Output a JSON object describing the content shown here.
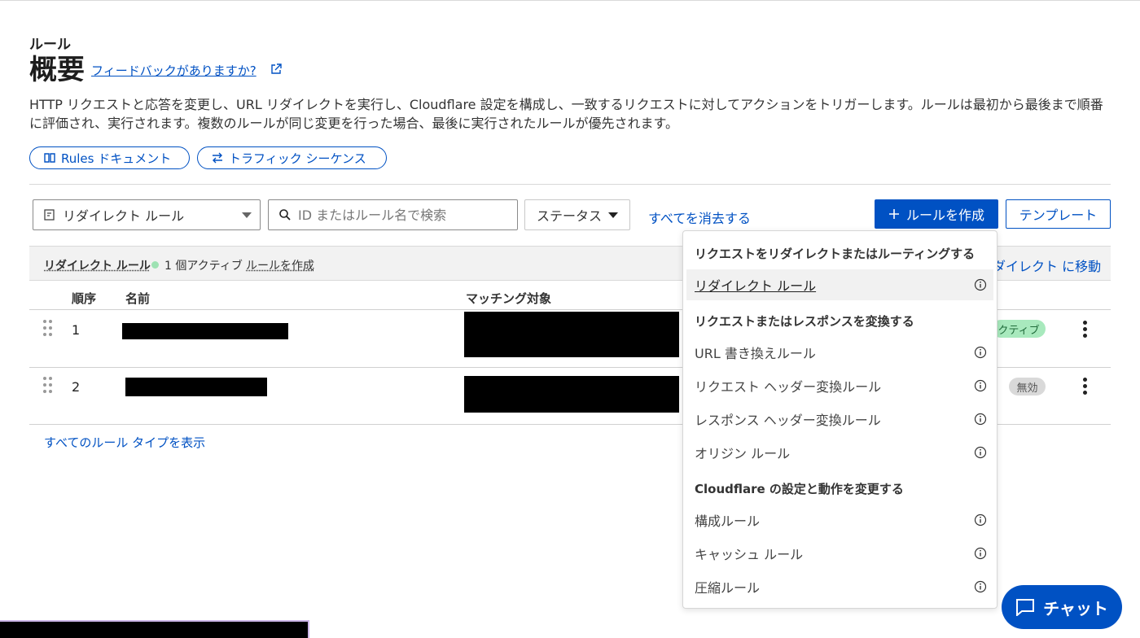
{
  "header": {
    "breadcrumb": "ルール",
    "title": "概要",
    "feedback_link": "フィードバックがありますか?",
    "description": "HTTP リクエストと応答を変更し、URL リダイレクトを実行し、Cloudflare 設定を構成し、一致するリクエストに対してアクションをトリガーします。ルールは最初から最後まで順番に評価され、実行されます。複数のルールが同じ変更を行った場合、最後に実行されたルールが優先されます。"
  },
  "pills": {
    "docs": "Rules ドキュメント",
    "sequence": "トラフィック シーケンス"
  },
  "toolbar": {
    "rule_type_select": "リダイレクト ルール",
    "search_placeholder": "ID またはルール名で検索",
    "status_filter": "ステータス",
    "clear_all": "すべてを消去する",
    "create_button": "ルールを作成",
    "template_button": "テンプレート"
  },
  "table": {
    "group_title": "リダイレクト ルール",
    "active_count": "1 個アクティブ",
    "create_rule_link": "ルールを作成",
    "goto_link": "ダイレクト に移動",
    "columns": [
      "順序",
      "名前",
      "マッチング対象"
    ],
    "rows": [
      {
        "order": "1",
        "status": "クティブ"
      },
      {
        "order": "2",
        "status": "無効"
      }
    ],
    "show_all_link": "すべてのルール タイプを表示"
  },
  "menu": {
    "sections": [
      {
        "heading": "リクエストをリダイレクトまたはルーティングする",
        "items": [
          "リダイレクト ルール"
        ]
      },
      {
        "heading": "リクエストまたはレスポンスを変換する",
        "items": [
          "URL 書き換えルール",
          "リクエスト ヘッダー変換ルール",
          "レスポンス ヘッダー変換ルール",
          "オリジン ルール"
        ]
      },
      {
        "heading": "Cloudflare の設定と動作を変更する",
        "items": [
          "構成ルール",
          "キャッシュ ルール",
          "圧縮ルール"
        ]
      }
    ]
  },
  "chat": {
    "label": "チャット"
  },
  "colors": {
    "accent": "#0051c3",
    "active_badge": "#a8e9bd",
    "disabled_badge": "#d9d9d9"
  }
}
